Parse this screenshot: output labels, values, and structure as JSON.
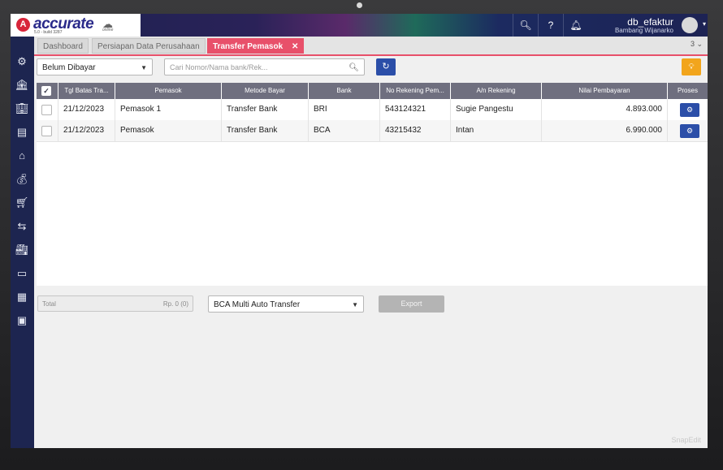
{
  "app": {
    "brand": "accurate",
    "version": "5.0 - build 3287",
    "cloud_label": "online",
    "db_name": "db_efaktur",
    "user_name": "Bambang Wijanarko"
  },
  "sidebar": {
    "icons": [
      "gear-icon",
      "bank-icon",
      "building-icon",
      "ledger-icon",
      "house-money-icon",
      "moneybag-icon",
      "cart-icon",
      "cart-return-icon",
      "factory-icon",
      "cash-icon",
      "report-icon",
      "calculator-icon"
    ]
  },
  "tabs": [
    {
      "label": "Dashboard"
    },
    {
      "label": "Persiapan Data Perusahaan"
    },
    {
      "label": "Transfer Pemasok"
    }
  ],
  "tab_count": "3",
  "toolbar": {
    "status_value": "Belum Dibayar",
    "search_placeholder": "Cari Nomor/Nama bank/Rek..."
  },
  "table": {
    "headers": {
      "due_date": "Tgl Batas Tra...",
      "supplier": "Pemasok",
      "payment_method": "Metode Bayar",
      "bank": "Bank",
      "account_no": "No Rekening Pem...",
      "account_name": "A/n Rekening",
      "amount": "Nilai Pembayaran",
      "process": "Proses"
    },
    "rows": [
      {
        "due_date": "21/12/2023",
        "supplier": "Pemasok 1",
        "payment_method": "Transfer Bank",
        "bank": "BRI",
        "account_no": "543124321",
        "account_name": "Sugie Pangestu",
        "amount": "4.893.000"
      },
      {
        "due_date": "21/12/2023",
        "supplier": "Pemasok",
        "payment_method": "Transfer Bank",
        "bank": "BCA",
        "account_no": "43215432",
        "account_name": "Intan",
        "amount": "6.990.000"
      }
    ]
  },
  "footer": {
    "total_label": "Total",
    "total_value": "Rp. 0 (0)",
    "bank_option": "BCA Multi Auto Transfer",
    "export_label": "Export"
  },
  "watermark": "SnapEdit",
  "colors": {
    "accent": "#e8506a",
    "sidebar": "#1d2550",
    "primary_button": "#2b4ea8",
    "warning_button": "#f2a51c",
    "table_header": "#6f6f7f"
  }
}
